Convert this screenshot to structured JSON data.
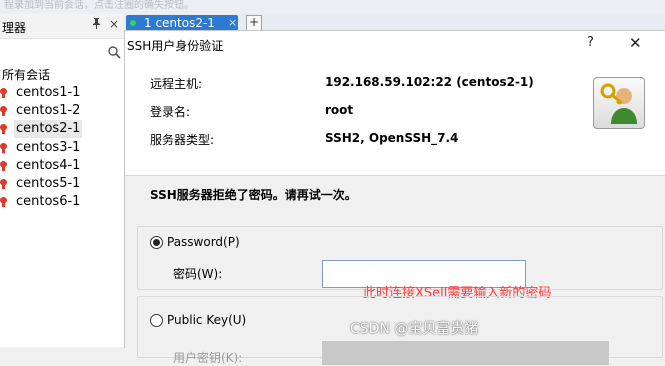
{
  "top_strip_text": "程录加到当前会话，点击注圈的确失按钮。",
  "sidebar": {
    "title": "理器",
    "pin": "ᵖ",
    "close": "×",
    "root_label": "所有会话",
    "sessions": [
      "centos1-1",
      "centos1-2",
      "centos2-1",
      "centos3-1",
      "centos4-1",
      "centos5-1",
      "centos6-1"
    ],
    "selected": "centos2-1"
  },
  "tabs": {
    "active_label": "1 centos2-1",
    "close": "×",
    "add": "+"
  },
  "dialog": {
    "title": "SSH用户身份验证",
    "help": "?",
    "close": "✕",
    "remote_host_label": "远程主机:",
    "remote_host_value": "192.168.59.102:22 (centos2-1)",
    "login_label": "登录名:",
    "login_value": "root",
    "server_type_label": "服务器类型:",
    "server_type_value": "SSH2, OpenSSH_7.4",
    "reject_message": "SSH服务器拒绝了密码。请再试一次。",
    "password_option": "Password(P)",
    "password_label": "密码(W):",
    "password_value": "",
    "pubkey_option": "Public Key(U)",
    "user_key_label": "用户密钥(K):",
    "selected_method": "Password"
  },
  "annotation": "此时连接XSell需要输入新的密码",
  "watermark": "CSDN @宝贝富贵猪",
  "colors": {
    "tab_active": "#2e7ad1",
    "annotation": "#ff3b3b",
    "session_icon": "#e0392b"
  }
}
